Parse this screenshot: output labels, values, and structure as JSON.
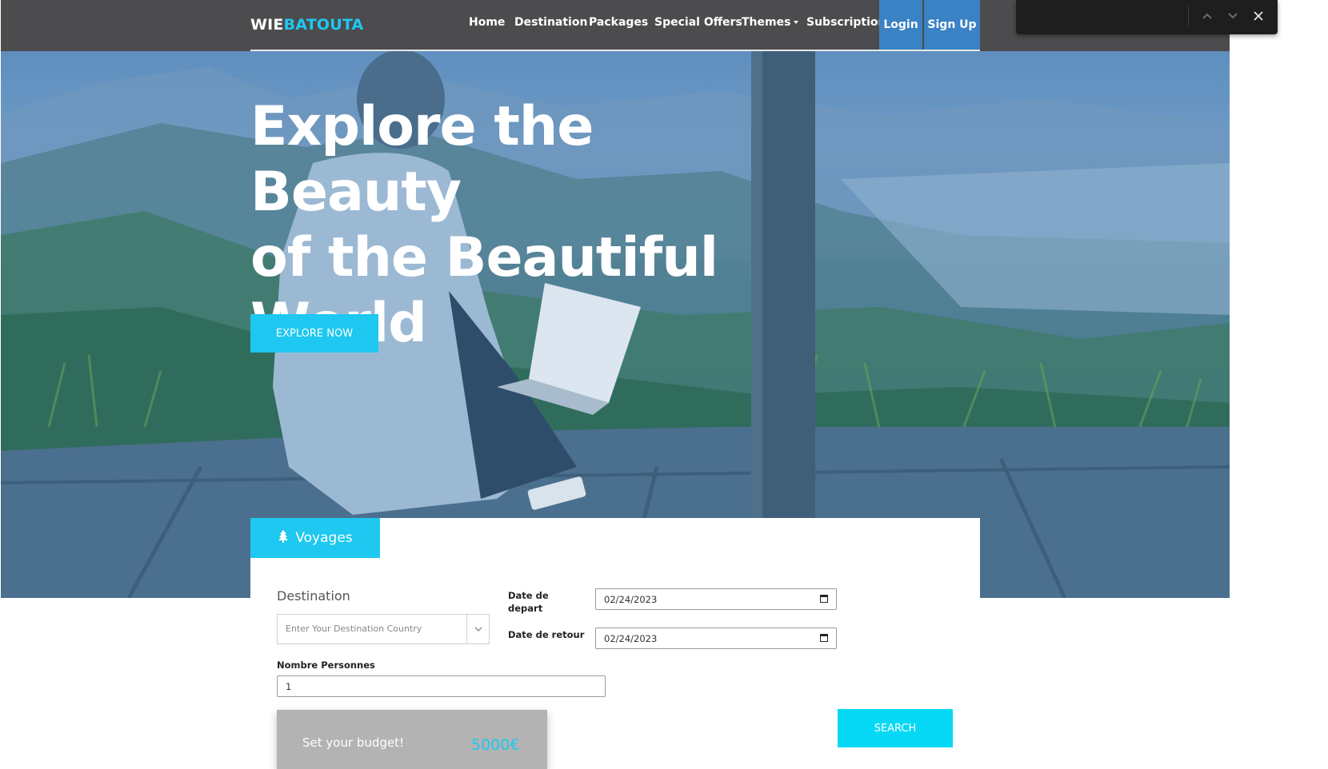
{
  "header": {
    "brand_part1": "WIE",
    "brand_part2": "BATOUTA",
    "nav": {
      "home": "Home",
      "destination": "Destination",
      "packages": "Packages",
      "special_offers": "Special Offers",
      "themes": "Themes",
      "subscription": "Subscription",
      "login": "Login",
      "signup": "Sign Up"
    }
  },
  "findbar": {
    "prev_icon": "chevron-up-icon",
    "next_icon": "chevron-down-icon",
    "close_icon": "close-icon"
  },
  "hero": {
    "headline_line1": "Explore the Beauty",
    "headline_line2": "of the Beautiful",
    "headline_line3": "World",
    "cta_label": "EXPLORE NOW"
  },
  "search": {
    "tab_label": "Voyages",
    "tab_icon": "tree-icon",
    "destination_label": "Destination",
    "destination_placeholder": "Enter Your Destination Country",
    "depart_label_line1": "Date de",
    "depart_label_line2": "depart",
    "depart_value": "02/24/2023",
    "return_label": "Date de retour",
    "return_value": "02/24/2023",
    "persons_label": "Nombre Personnes",
    "persons_value": "1",
    "budget_label": "Set your budget!",
    "budget_value": "5000€",
    "search_label": "SEARCH"
  },
  "colors": {
    "accent": "#1ec8f0",
    "nav_bg": "#4c4c4e",
    "nav_button": "#3a82c4",
    "budget_bg": "#b3b3b3"
  }
}
